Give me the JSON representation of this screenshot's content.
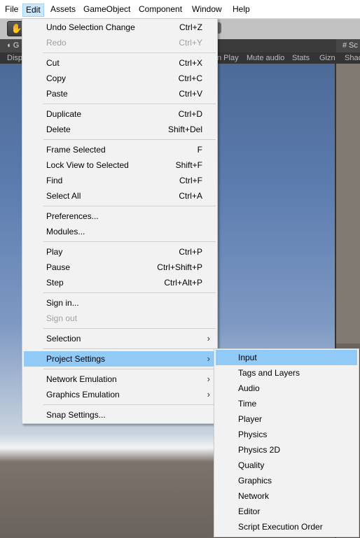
{
  "menubar": {
    "items": [
      "File",
      "Edit",
      "Assets",
      "GameObject",
      "Component",
      "Window",
      "Help"
    ],
    "active": "Edit"
  },
  "game_view": {
    "tab_label": "G",
    "options": [
      "Disp",
      "n Play",
      "Mute audio",
      "Stats",
      "Gizn"
    ]
  },
  "scene_view": {
    "tab_label": "Sc",
    "option": "Shac"
  },
  "edit_menu": {
    "items": [
      {
        "label": "Undo Selection Change",
        "shortcut": "Ctrl+Z"
      },
      {
        "label": "Redo",
        "shortcut": "Ctrl+Y",
        "disabled": true
      },
      {
        "label": "Cut",
        "shortcut": "Ctrl+X"
      },
      {
        "label": "Copy",
        "shortcut": "Ctrl+C"
      },
      {
        "label": "Paste",
        "shortcut": "Ctrl+V"
      },
      {
        "label": "Duplicate",
        "shortcut": "Ctrl+D"
      },
      {
        "label": "Delete",
        "shortcut": "Shift+Del"
      },
      {
        "label": "Frame Selected",
        "shortcut": "F"
      },
      {
        "label": "Lock View to Selected",
        "shortcut": "Shift+F"
      },
      {
        "label": "Find",
        "shortcut": "Ctrl+F"
      },
      {
        "label": "Select All",
        "shortcut": "Ctrl+A"
      },
      {
        "label": "Preferences...",
        "shortcut": ""
      },
      {
        "label": "Modules...",
        "shortcut": ""
      },
      {
        "label": "Play",
        "shortcut": "Ctrl+P"
      },
      {
        "label": "Pause",
        "shortcut": "Ctrl+Shift+P"
      },
      {
        "label": "Step",
        "shortcut": "Ctrl+Alt+P"
      },
      {
        "label": "Sign in...",
        "shortcut": ""
      },
      {
        "label": "Sign out",
        "shortcut": "",
        "disabled": true
      },
      {
        "label": "Selection",
        "shortcut": "",
        "submenu": true
      },
      {
        "label": "Project Settings",
        "shortcut": "",
        "submenu": true,
        "highlighted": true
      },
      {
        "label": "Network Emulation",
        "shortcut": "",
        "submenu": true
      },
      {
        "label": "Graphics Emulation",
        "shortcut": "",
        "submenu": true
      },
      {
        "label": "Snap Settings...",
        "shortcut": ""
      }
    ]
  },
  "project_settings_menu": {
    "items": [
      "Input",
      "Tags and Layers",
      "Audio",
      "Time",
      "Player",
      "Physics",
      "Physics 2D",
      "Quality",
      "Graphics",
      "Network",
      "Editor",
      "Script Execution Order"
    ],
    "highlighted": "Input"
  },
  "colors": {
    "menu_bg": "#f2f2f2",
    "menu_highlight": "#91c9f7",
    "menubar_active": "#cce8ff",
    "disabled_text": "#a0a0a0"
  },
  "icons": {
    "submenu_arrow": "chevron-right-icon",
    "hand_tool": "hand-icon",
    "scene_grid": "grid-icon"
  }
}
